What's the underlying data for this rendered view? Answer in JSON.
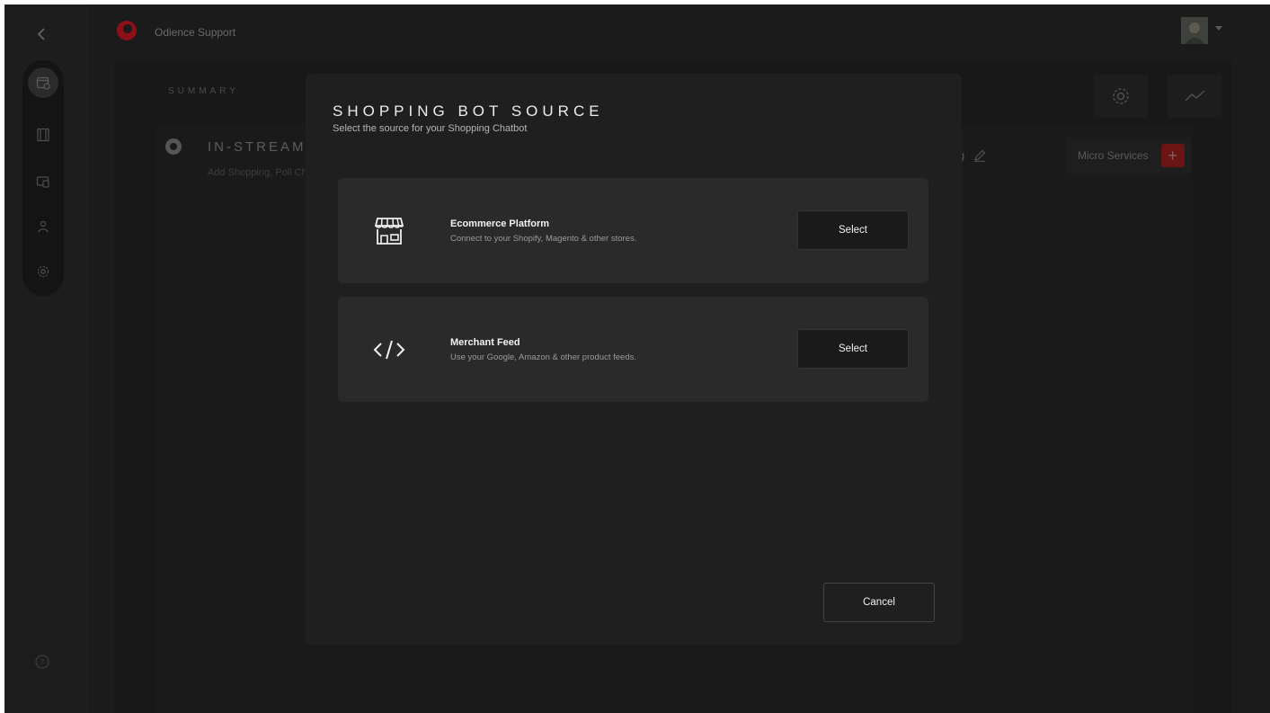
{
  "topbar": {
    "brand_name": "Odience Support"
  },
  "background": {
    "summary_tab": "SUMMARY",
    "panel_title": "IN-STREAM S",
    "panel_subtitle": "Add Shopping, Poll Ch",
    "branding_label": "randing",
    "micro_services_label": "Micro Services",
    "plus_label": "+"
  },
  "modal": {
    "title": "SHOPPING BOT SOURCE",
    "subtitle": "Select the source for your Shopping Chatbot",
    "options": [
      {
        "icon": "storefront-icon",
        "title": "Ecommerce Platform",
        "description": "Connect to your Shopify, Magento & other stores.",
        "button": "Select"
      },
      {
        "icon": "code-icon",
        "title": "Merchant Feed",
        "description": "Use your Google, Amazon & other product feeds.",
        "button": "Select"
      }
    ],
    "cancel_label": "Cancel"
  },
  "colors": {
    "accent": "#b3121f",
    "modal_bg": "#1f1f1f",
    "card_bg": "#2a2a2a"
  }
}
